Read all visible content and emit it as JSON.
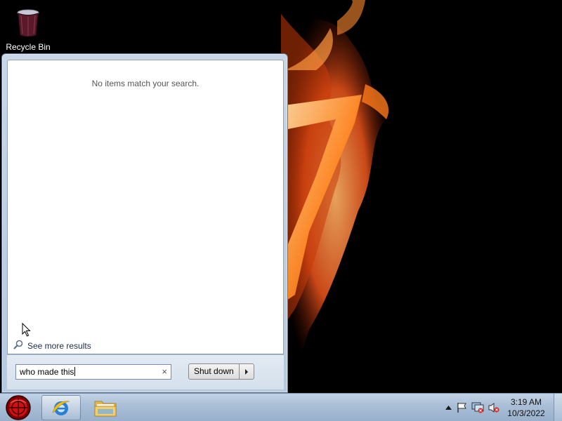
{
  "desktop": {
    "icons": [
      {
        "label": "Recycle Bin",
        "icon": "recycle-bin-icon"
      }
    ]
  },
  "start_menu": {
    "no_results_text": "No items match your search.",
    "see_more_label": "See more results",
    "search": {
      "value": "who made this",
      "clear_glyph": "×"
    },
    "shutdown_label": "Shut down",
    "shutdown_arrow_glyph": "▸"
  },
  "taskbar": {
    "start_button": "start-orb-icon",
    "pinned": [
      {
        "name": "Internet Explorer",
        "icon": "internet-explorer-icon",
        "active": true
      },
      {
        "name": "Windows Explorer",
        "icon": "folder-icon",
        "active": false
      }
    ],
    "tray": {
      "icons": [
        "show-hidden-icons-arrow",
        "action-center-flag-icon",
        "network-icon",
        "volume-muted-icon"
      ],
      "time": "3:19 AM",
      "date": "10/3/2022"
    }
  },
  "colors": {
    "taskbar": "#a9bed6",
    "start_menu_frame": "#b7c9dd",
    "results_bg": "#ffffff",
    "fire": "#ff7a1a"
  }
}
